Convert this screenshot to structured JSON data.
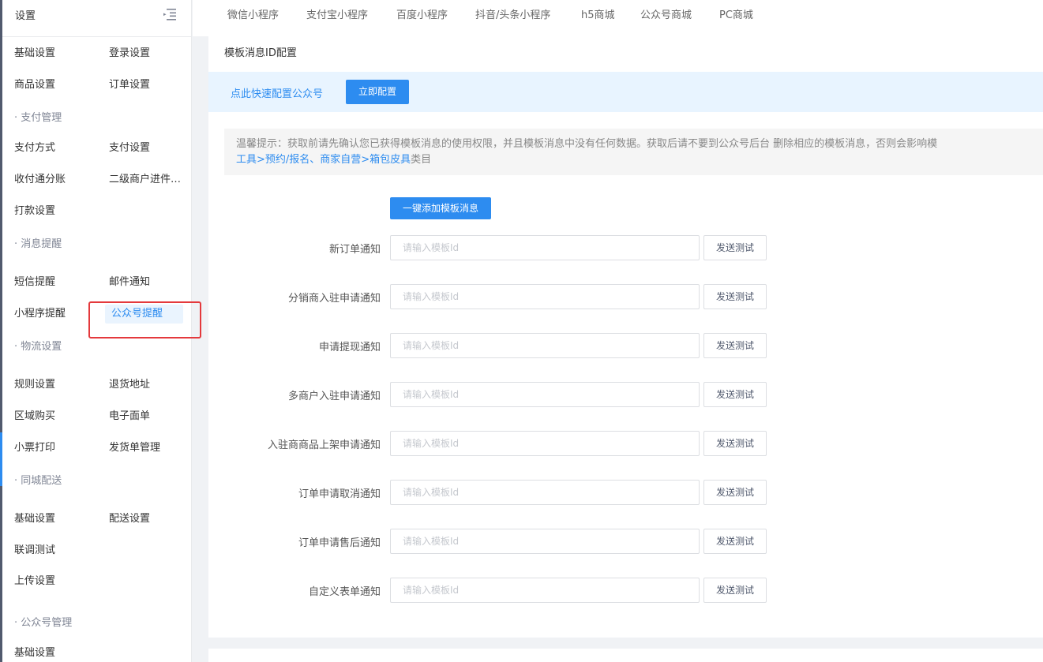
{
  "sidebar": {
    "title": "设置",
    "rows": [
      {
        "type": "items",
        "items": [
          "基础设置",
          "登录设置"
        ]
      },
      {
        "type": "items",
        "items": [
          "商品设置",
          "订单设置"
        ]
      },
      {
        "type": "group",
        "label": "· 支付管理"
      },
      {
        "type": "items",
        "items": [
          "支付方式",
          "支付设置"
        ]
      },
      {
        "type": "items",
        "items": [
          "收付通分账",
          "二级商户进件管理"
        ]
      },
      {
        "type": "items",
        "items": [
          "打款设置"
        ]
      },
      {
        "type": "group",
        "label": "· 消息提醒",
        "tall": true
      },
      {
        "type": "items",
        "items": [
          "短信提醒",
          "邮件通知"
        ]
      },
      {
        "type": "items",
        "items": [
          "小程序提醒",
          "公众号提醒"
        ],
        "active": 1
      },
      {
        "type": "group",
        "label": "· 物流设置",
        "tall": true
      },
      {
        "type": "items",
        "items": [
          "规则设置",
          "退货地址"
        ]
      },
      {
        "type": "items",
        "items": [
          "区域购买",
          "电子面单"
        ]
      },
      {
        "type": "items",
        "items": [
          "小票打印",
          "发货单管理"
        ]
      },
      {
        "type": "group",
        "label": "· 同城配送",
        "tall": true
      },
      {
        "type": "items",
        "items": [
          "基础设置",
          "配送设置"
        ]
      },
      {
        "type": "items",
        "items": [
          "联调测试"
        ]
      },
      {
        "type": "items",
        "items": [
          "上传设置"
        ],
        "tall": true
      },
      {
        "type": "group",
        "label": "· 公众号管理"
      },
      {
        "type": "items",
        "items": [
          "基础设置"
        ]
      }
    ]
  },
  "tabs": [
    "微信小程序",
    "支付宝小程序",
    "百度小程序",
    "抖音/头条小程序",
    "h5商城",
    "公众号商城",
    "PC商城"
  ],
  "card": {
    "title": "模板消息ID配置",
    "quick_text": "点此快速配置公众号",
    "quick_button": "立即配置",
    "tip_line1": "温馨提示：获取前请先确认您已获得模板消息的使用权限，并且模板消息中没有任何数据。获取后请不要到公众号后台 删除相应的模板消息，否则会影响模",
    "tip_link": "工具>预约/报名、商家自营>箱包皮具",
    "tip_tail": "类目",
    "add_button": "一键添加模板消息",
    "placeholder": "请输入模板Id",
    "test_button": "发送测试",
    "fields": [
      "新订单通知",
      "分销商入驻申请通知",
      "申请提现通知",
      "多商户入驻申请通知",
      "入驻商商品上架申请通知",
      "订单申请取消通知",
      "订单申请售后通知",
      "自定义表单通知"
    ]
  },
  "colors": {
    "accent": "#2d8cf0",
    "highlight": "#e4393c",
    "quickbar": "#e8f4ff"
  }
}
